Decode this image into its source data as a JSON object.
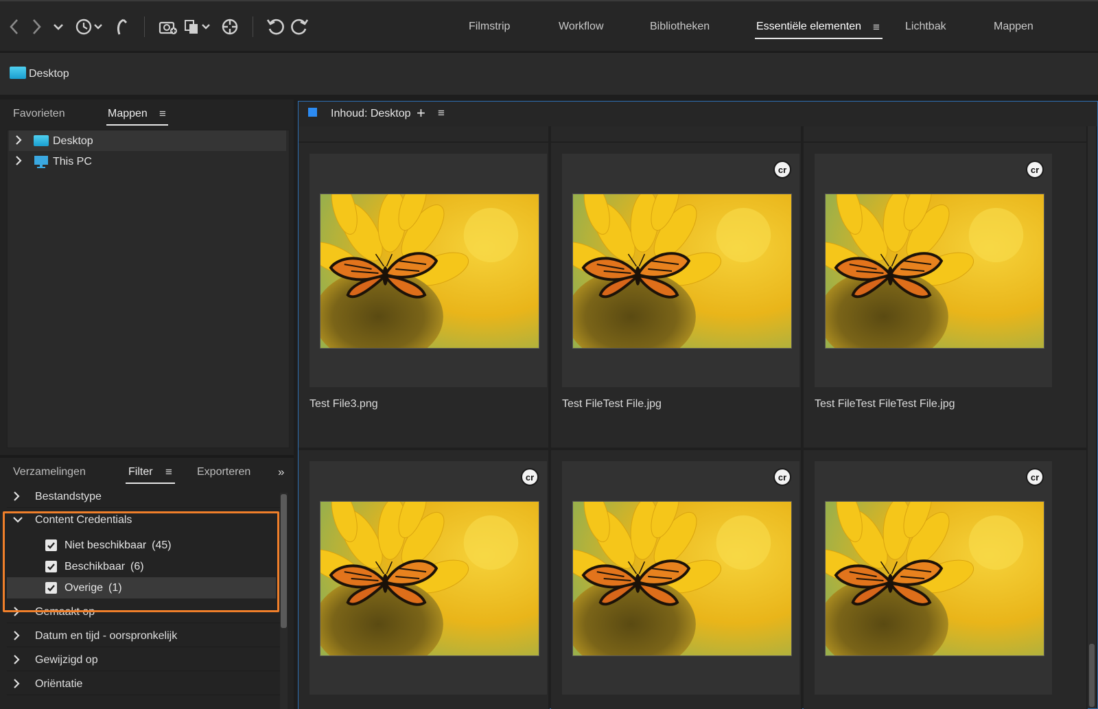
{
  "toolbar": {
    "icons": [
      "back-arrow-icon",
      "forward-arrow-icon",
      "chevron-down-icon",
      "recent-history-icon",
      "boomerang-icon",
      "camera-get-photos-icon",
      "copy-icon",
      "refine-icon",
      "rotate-left-icon",
      "rotate-right-icon"
    ]
  },
  "workspaces": {
    "tabs": [
      {
        "label": "Filmstrip"
      },
      {
        "label": "Workflow"
      },
      {
        "label": "Bibliotheken"
      },
      {
        "label": "Essentiële elementen",
        "active": true
      },
      {
        "label": "Lichtbak"
      },
      {
        "label": "Mappen"
      }
    ],
    "menu_glyph": "≡"
  },
  "path": {
    "label": "Desktop"
  },
  "left_top": {
    "tabs": [
      {
        "label": "Favorieten"
      },
      {
        "label": "Mappen",
        "active": true
      }
    ],
    "menu_glyph": "≡",
    "tree": [
      {
        "label": "Desktop",
        "selected": true,
        "icon": "desktop-folder-icon"
      },
      {
        "label": "This PC",
        "selected": false,
        "icon": "computer-icon"
      }
    ]
  },
  "left_bottom": {
    "tabs": [
      {
        "label": "Verzamelingen"
      },
      {
        "label": "Filter",
        "active": true
      },
      {
        "label": "Exporteren"
      }
    ],
    "menu_glyph": "≡",
    "collapse_glyph": "»",
    "filters": [
      {
        "label": "Bestandstype",
        "expanded": false
      },
      {
        "label": "Content Credentials",
        "expanded": true,
        "options": [
          {
            "label": "Niet beschikbaar",
            "count": "(45)",
            "checked": true
          },
          {
            "label": "Beschikbaar",
            "count": "(6)",
            "checked": true
          },
          {
            "label": "Overige",
            "count": "(1)",
            "checked": true
          }
        ]
      },
      {
        "label": "Gemaakt op",
        "expanded": false
      },
      {
        "label": "Datum en tijd - oorspronkelijk",
        "expanded": false
      },
      {
        "label": "Gewijzigd op",
        "expanded": false
      },
      {
        "label": "Oriëntatie",
        "expanded": false
      }
    ],
    "highlight_color": "#f07f2a"
  },
  "content": {
    "title": "Inhoud: Desktop",
    "plus_glyph": "+",
    "menu_glyph": "≡",
    "items": [
      {
        "name": "Test File3.png",
        "cr_badge": false
      },
      {
        "name": "Test FileTest File.jpg",
        "cr_badge": true
      },
      {
        "name": "Test FileTest FileTest File.jpg",
        "cr_badge": true
      },
      {
        "name": "",
        "cr_badge": true
      },
      {
        "name": "",
        "cr_badge": true
      },
      {
        "name": "",
        "cr_badge": true
      }
    ],
    "badge_text": "cr",
    "accent": "#2c8bf2"
  }
}
